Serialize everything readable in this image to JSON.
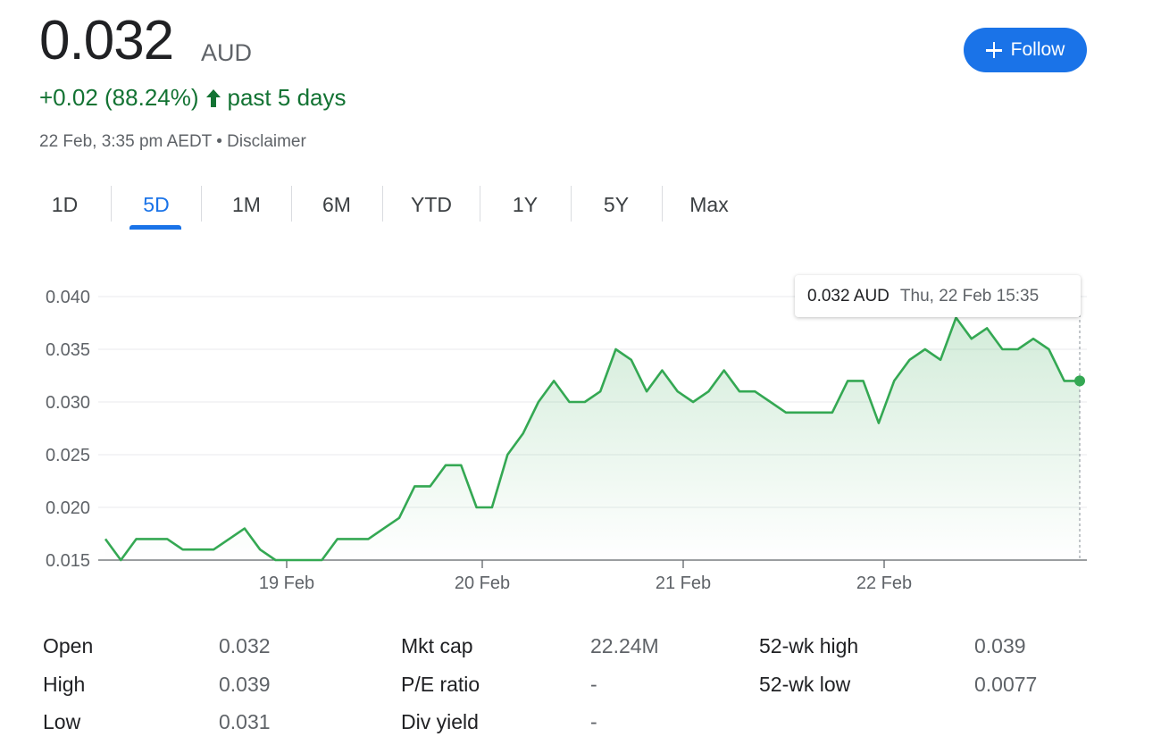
{
  "header": {
    "price": "0.032",
    "currency": "AUD",
    "change": "+0.02 (88.24%)",
    "period": "past 5 days",
    "timestamp": "22 Feb, 3:35 pm AEDT",
    "separator": "•",
    "disclaimer": "Disclaimer",
    "follow_label": "Follow"
  },
  "colors": {
    "up": "#137333",
    "accent": "#1a73e8",
    "line": "#34a853"
  },
  "tabs": [
    {
      "label": "1D",
      "active": false
    },
    {
      "label": "5D",
      "active": true
    },
    {
      "label": "1M",
      "active": false
    },
    {
      "label": "6M",
      "active": false
    },
    {
      "label": "YTD",
      "active": false
    },
    {
      "label": "1Y",
      "active": false
    },
    {
      "label": "5Y",
      "active": false
    },
    {
      "label": "Max",
      "active": false
    }
  ],
  "tooltip": {
    "value": "0.032 AUD",
    "time": "Thu, 22 Feb 15:35"
  },
  "chart_data": {
    "type": "area",
    "title": "",
    "xlabel": "",
    "ylabel": "",
    "y_ticks": [
      "0.040",
      "0.035",
      "0.030",
      "0.025",
      "0.020",
      "0.015"
    ],
    "x_ticks": [
      "19 Feb",
      "20 Feb",
      "21 Feb",
      "22 Feb"
    ],
    "ylim": [
      0.015,
      0.04
    ],
    "grid": true,
    "values": [
      0.017,
      0.015,
      0.017,
      0.017,
      0.017,
      0.016,
      0.016,
      0.016,
      0.017,
      0.018,
      0.016,
      0.015,
      0.015,
      0.015,
      0.015,
      0.017,
      0.017,
      0.017,
      0.018,
      0.019,
      0.022,
      0.022,
      0.024,
      0.024,
      0.02,
      0.02,
      0.025,
      0.027,
      0.03,
      0.032,
      0.03,
      0.03,
      0.031,
      0.035,
      0.034,
      0.031,
      0.033,
      0.031,
      0.03,
      0.031,
      0.033,
      0.031,
      0.031,
      0.03,
      0.029,
      0.029,
      0.029,
      0.029,
      0.032,
      0.032,
      0.028,
      0.032,
      0.034,
      0.035,
      0.034,
      0.038,
      0.036,
      0.037,
      0.035,
      0.035,
      0.036,
      0.035,
      0.032,
      0.032
    ]
  },
  "stats": {
    "open_label": "Open",
    "open": "0.032",
    "high_label": "High",
    "high": "0.039",
    "low_label": "Low",
    "low": "0.031",
    "mktcap_label": "Mkt cap",
    "mktcap": "22.24M",
    "pe_label": "P/E ratio",
    "pe": "-",
    "div_label": "Div yield",
    "div": "-",
    "wkhigh_label": "52-wk high",
    "wkhigh": "0.039",
    "wklow_label": "52-wk low",
    "wklow": "0.0077"
  }
}
